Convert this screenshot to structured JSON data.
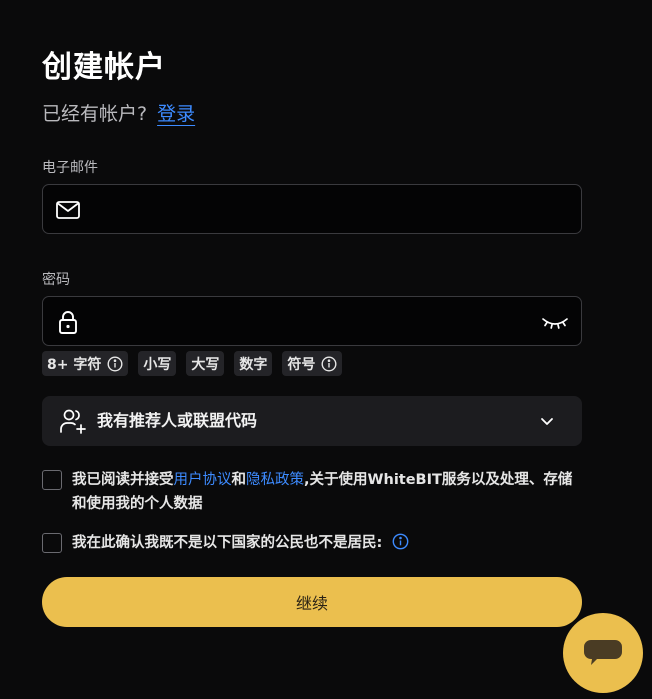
{
  "title": "创建帐户",
  "login_prompt": {
    "text": "已经有帐户?",
    "link": "登录"
  },
  "email": {
    "label": "电子邮件",
    "value": "",
    "placeholder": "",
    "icon": "mail-icon"
  },
  "password": {
    "label": "密码",
    "value": "",
    "placeholder": "",
    "icon": "lock-icon",
    "toggle_icon": "eye-closed-icon",
    "requirements": [
      {
        "label": "8+ 字符",
        "has_info": true
      },
      {
        "label": "小写",
        "has_info": false
      },
      {
        "label": "大写",
        "has_info": false
      },
      {
        "label": "数字",
        "has_info": false
      },
      {
        "label": "符号",
        "has_info": true
      }
    ]
  },
  "referral": {
    "label": "我有推荐人或联盟代码",
    "icon": "add-user-icon",
    "expand_icon": "chevron-down-icon"
  },
  "terms": {
    "checked": false,
    "prefix": "我已阅读并接受",
    "user_agreement": "用户协议",
    "and": "和",
    "privacy_policy": "隐私政策",
    "suffix": ",关于使用WhiteBIT服务以及处理、存储和使用我的个人数据"
  },
  "residency": {
    "checked": false,
    "text": "我在此确认我既不是以下国家的公民也不是居民:"
  },
  "continue_label": "继续",
  "colors": {
    "background": "#0a0a0b",
    "accent": "#ebbf4e",
    "link": "#3d8bff",
    "field_border": "#3a3a3e",
    "chip_bg": "#242428"
  },
  "chat_icon": "chat-bubble-icon"
}
